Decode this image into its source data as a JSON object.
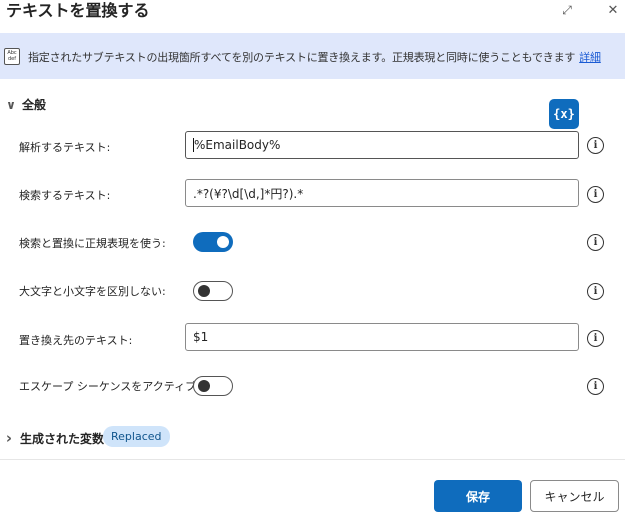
{
  "dialog": {
    "title": "テキストを置換する",
    "expand_glyph": "⤢",
    "close_glyph": "✕"
  },
  "banner": {
    "icon_text": "Abc def",
    "description": "指定されたサブテキストの出現箇所すべてを別のテキストに置き換えます。正規表現と同時に使うこともできます",
    "link": "詳細"
  },
  "sections": {
    "general": "全般",
    "generated_vars": "生成された変数",
    "generated_badge": "Replaced"
  },
  "variable_button": "{x}",
  "fields": {
    "text_to_parse": {
      "label": "解析するテキスト:",
      "value": "%EmailBody%"
    },
    "text_to_find": {
      "label": "検索するテキスト:",
      "value": ".*?(¥?\\d[\\d,]*円?).*"
    },
    "use_regex": {
      "label": "検索と置換に正規表現を使う:",
      "enabled": true
    },
    "ignore_case": {
      "label": "大文字と小文字を区別しない:",
      "enabled": false
    },
    "replace_with": {
      "label": "置き換え先のテキスト:",
      "value": "$1"
    },
    "escape": {
      "label": "エスケープ シーケンスをアクティブ化:",
      "enabled": false
    }
  },
  "icons": {
    "info": "i",
    "chevron_down": "∨",
    "chevron_right": "›"
  },
  "buttons": {
    "save": "保存",
    "cancel": "キャンセル"
  },
  "colors": {
    "accent": "#0f6cbd",
    "banner_bg": "#dfe7fb",
    "badge_bg": "#cfe4fa"
  }
}
